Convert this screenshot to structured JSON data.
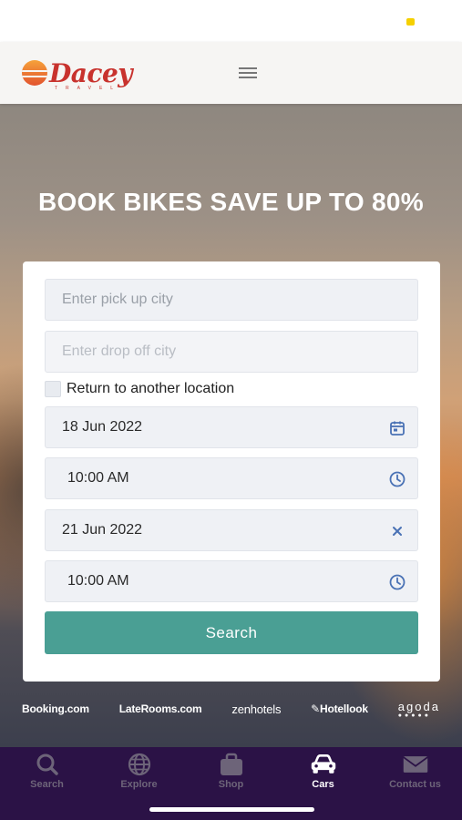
{
  "header": {
    "brand": "Dacey",
    "brand_sub": "TRAVEL"
  },
  "hero": {
    "title": "BOOK BIKES SAVE UP TO 80%"
  },
  "form": {
    "pickup_placeholder": "Enter pick up city",
    "dropoff_placeholder": "Enter drop off city",
    "return_label": "Return to another location",
    "pickup_date": "18 Jun 2022",
    "pickup_time": "10:00 AM",
    "dropoff_date": "21 Jun 2022",
    "dropoff_time": "10:00 AM",
    "search_label": "Search"
  },
  "partners": [
    "Booking.com",
    "LateRooms.com",
    "zenhotels",
    "Hotellook",
    "agoda"
  ],
  "tabs": [
    {
      "label": "Search",
      "icon": "search-icon",
      "active": false
    },
    {
      "label": "Explore",
      "icon": "globe-icon",
      "active": false
    },
    {
      "label": "Shop",
      "icon": "bag-icon",
      "active": false
    },
    {
      "label": "Cars",
      "icon": "car-icon",
      "active": true
    },
    {
      "label": "Contact us",
      "icon": "envelope-icon",
      "active": false
    }
  ],
  "colors": {
    "brand_red": "#c8322d",
    "search_button": "#4a9f94",
    "tabbar_bg": "#2b1246",
    "icon_blue": "#4a72b5"
  }
}
